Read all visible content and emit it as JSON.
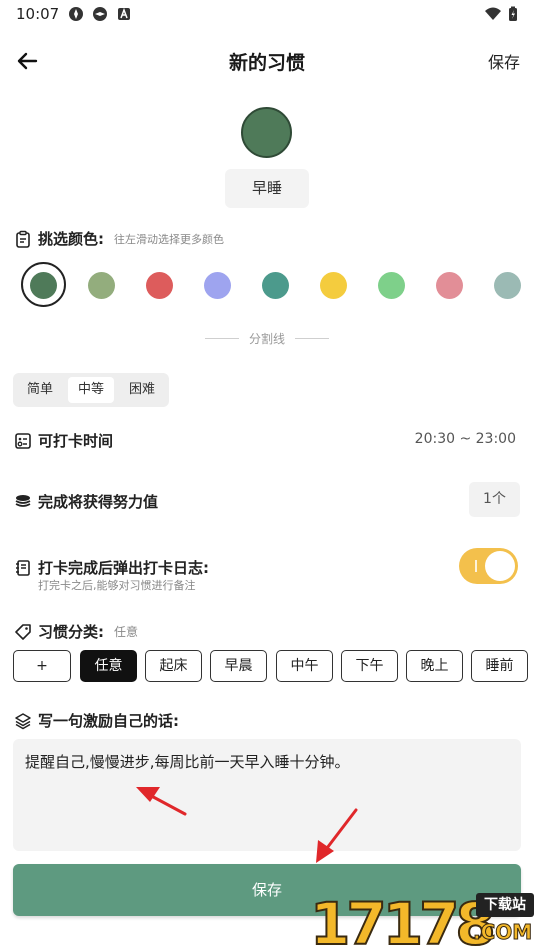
{
  "status_bar": {
    "time": "10:07"
  },
  "header": {
    "title": "新的习惯",
    "save_label": "保存"
  },
  "preview": {
    "name": "早睡",
    "color": "#4f7a59"
  },
  "color_section": {
    "title": "挑选颜色:",
    "hint": "往左滑动选择更多颜色",
    "swatches": [
      "#4f7a59",
      "#93ad7d",
      "#dd5c5c",
      "#9ea4ef",
      "#4c9a8c",
      "#f4cc3e",
      "#7ed08a",
      "#e28e97",
      "#9bbab4"
    ],
    "selected_index": 0
  },
  "divider_text": "分割线",
  "difficulty": {
    "options": [
      "简单",
      "中等",
      "困难"
    ],
    "selected": "中等"
  },
  "checkin_time": {
    "label": "可打卡时间",
    "value": "20:30 ~ 23:00"
  },
  "effort": {
    "label": "完成将获得努力值",
    "value": "1个"
  },
  "log_popup": {
    "label": "打卡完成后弹出打卡日志:",
    "sub": "打完卡之后,能够对习惯进行备注",
    "enabled": true
  },
  "category": {
    "title": "习惯分类:",
    "current": "任意",
    "chips": [
      "+",
      "任意",
      "起床",
      "早晨",
      "中午",
      "下午",
      "晚上",
      "睡前"
    ],
    "selected": "任意"
  },
  "motto": {
    "title": "写一句激励自己的话:",
    "value": "提醒自己,慢慢进步,每周比前一天早入睡十分钟。"
  },
  "bottom": {
    "save_label": "保存"
  },
  "watermark": {
    "text": "17178",
    "sub": "下载站",
    "domain": ".COM"
  },
  "colors": {
    "accent": "#5e9a80",
    "toggle": "#f3c04c",
    "arrow": "#e0272a"
  }
}
